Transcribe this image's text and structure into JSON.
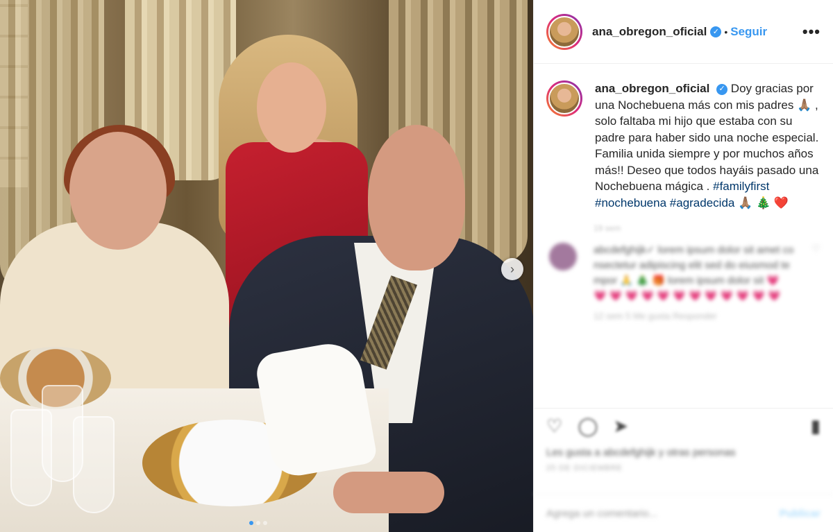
{
  "header": {
    "username": "ana_obregon_oficial",
    "separator": "•",
    "follow_label": "Seguir",
    "more_label": "•••",
    "verified_icon": "✓"
  },
  "caption": {
    "username": "ana_obregon_oficial",
    "body_1": "Doy gracias por una Nochebuena más con mis padres 🙏🏽 , solo faltaba mi hijo que estaba con su padre para haber sido una noche especial. Familia unida siempre y por muchos años más!! Deseo que todos hayáis pasado una Nochebuena mágica . ",
    "tag_1": "#familyfirst",
    "tag_2": "#nochebuena",
    "tag_3": "#agradecida",
    "emojis": " 🙏🏽 🎄 ❤️",
    "time": "19 sem"
  },
  "comment": {
    "text": "abcdefghijk✓ lorem ipsum dolor sit amet consectetur adipiscing elit sed do eiusmod tempor 🙏 🎄 🎁 lorem ipsum dolor sit 💗 💗 💗 💗 💗 💗 💗 💗 💗 💗 💗 💗 💗",
    "meta": "12 sem   5 Me gusta   Responder",
    "heart_icon": "♡"
  },
  "actions": {
    "like_icon": "♡",
    "comment_icon": "◯",
    "share_icon": "➤",
    "save_icon": "▮",
    "likes_text": "Les gusta a abcdefghijk y otras personas",
    "date": "25 DE DICIEMBRE"
  },
  "add_comment": {
    "placeholder": "Agrega un comentario...",
    "publish_label": "Publicar"
  },
  "carousel": {
    "next_icon": "›"
  }
}
